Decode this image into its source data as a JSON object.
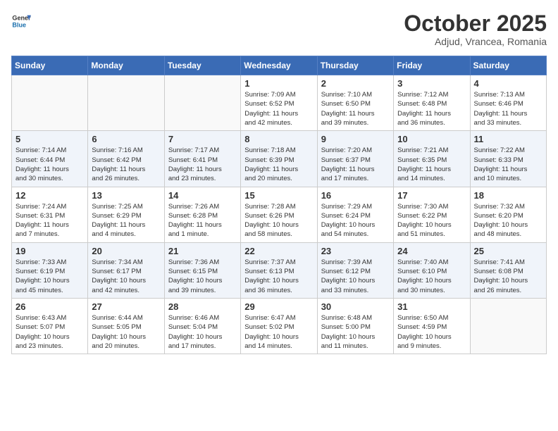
{
  "header": {
    "logo_line1": "General",
    "logo_line2": "Blue",
    "month": "October 2025",
    "location": "Adjud, Vrancea, Romania"
  },
  "weekdays": [
    "Sunday",
    "Monday",
    "Tuesday",
    "Wednesday",
    "Thursday",
    "Friday",
    "Saturday"
  ],
  "weeks": [
    [
      {
        "day": "",
        "info": ""
      },
      {
        "day": "",
        "info": ""
      },
      {
        "day": "",
        "info": ""
      },
      {
        "day": "1",
        "info": "Sunrise: 7:09 AM\nSunset: 6:52 PM\nDaylight: 11 hours\nand 42 minutes."
      },
      {
        "day": "2",
        "info": "Sunrise: 7:10 AM\nSunset: 6:50 PM\nDaylight: 11 hours\nand 39 minutes."
      },
      {
        "day": "3",
        "info": "Sunrise: 7:12 AM\nSunset: 6:48 PM\nDaylight: 11 hours\nand 36 minutes."
      },
      {
        "day": "4",
        "info": "Sunrise: 7:13 AM\nSunset: 6:46 PM\nDaylight: 11 hours\nand 33 minutes."
      }
    ],
    [
      {
        "day": "5",
        "info": "Sunrise: 7:14 AM\nSunset: 6:44 PM\nDaylight: 11 hours\nand 30 minutes."
      },
      {
        "day": "6",
        "info": "Sunrise: 7:16 AM\nSunset: 6:42 PM\nDaylight: 11 hours\nand 26 minutes."
      },
      {
        "day": "7",
        "info": "Sunrise: 7:17 AM\nSunset: 6:41 PM\nDaylight: 11 hours\nand 23 minutes."
      },
      {
        "day": "8",
        "info": "Sunrise: 7:18 AM\nSunset: 6:39 PM\nDaylight: 11 hours\nand 20 minutes."
      },
      {
        "day": "9",
        "info": "Sunrise: 7:20 AM\nSunset: 6:37 PM\nDaylight: 11 hours\nand 17 minutes."
      },
      {
        "day": "10",
        "info": "Sunrise: 7:21 AM\nSunset: 6:35 PM\nDaylight: 11 hours\nand 14 minutes."
      },
      {
        "day": "11",
        "info": "Sunrise: 7:22 AM\nSunset: 6:33 PM\nDaylight: 11 hours\nand 10 minutes."
      }
    ],
    [
      {
        "day": "12",
        "info": "Sunrise: 7:24 AM\nSunset: 6:31 PM\nDaylight: 11 hours\nand 7 minutes."
      },
      {
        "day": "13",
        "info": "Sunrise: 7:25 AM\nSunset: 6:29 PM\nDaylight: 11 hours\nand 4 minutes."
      },
      {
        "day": "14",
        "info": "Sunrise: 7:26 AM\nSunset: 6:28 PM\nDaylight: 11 hours\nand 1 minute."
      },
      {
        "day": "15",
        "info": "Sunrise: 7:28 AM\nSunset: 6:26 PM\nDaylight: 10 hours\nand 58 minutes."
      },
      {
        "day": "16",
        "info": "Sunrise: 7:29 AM\nSunset: 6:24 PM\nDaylight: 10 hours\nand 54 minutes."
      },
      {
        "day": "17",
        "info": "Sunrise: 7:30 AM\nSunset: 6:22 PM\nDaylight: 10 hours\nand 51 minutes."
      },
      {
        "day": "18",
        "info": "Sunrise: 7:32 AM\nSunset: 6:20 PM\nDaylight: 10 hours\nand 48 minutes."
      }
    ],
    [
      {
        "day": "19",
        "info": "Sunrise: 7:33 AM\nSunset: 6:19 PM\nDaylight: 10 hours\nand 45 minutes."
      },
      {
        "day": "20",
        "info": "Sunrise: 7:34 AM\nSunset: 6:17 PM\nDaylight: 10 hours\nand 42 minutes."
      },
      {
        "day": "21",
        "info": "Sunrise: 7:36 AM\nSunset: 6:15 PM\nDaylight: 10 hours\nand 39 minutes."
      },
      {
        "day": "22",
        "info": "Sunrise: 7:37 AM\nSunset: 6:13 PM\nDaylight: 10 hours\nand 36 minutes."
      },
      {
        "day": "23",
        "info": "Sunrise: 7:39 AM\nSunset: 6:12 PM\nDaylight: 10 hours\nand 33 minutes."
      },
      {
        "day": "24",
        "info": "Sunrise: 7:40 AM\nSunset: 6:10 PM\nDaylight: 10 hours\nand 30 minutes."
      },
      {
        "day": "25",
        "info": "Sunrise: 7:41 AM\nSunset: 6:08 PM\nDaylight: 10 hours\nand 26 minutes."
      }
    ],
    [
      {
        "day": "26",
        "info": "Sunrise: 6:43 AM\nSunset: 5:07 PM\nDaylight: 10 hours\nand 23 minutes."
      },
      {
        "day": "27",
        "info": "Sunrise: 6:44 AM\nSunset: 5:05 PM\nDaylight: 10 hours\nand 20 minutes."
      },
      {
        "day": "28",
        "info": "Sunrise: 6:46 AM\nSunset: 5:04 PM\nDaylight: 10 hours\nand 17 minutes."
      },
      {
        "day": "29",
        "info": "Sunrise: 6:47 AM\nSunset: 5:02 PM\nDaylight: 10 hours\nand 14 minutes."
      },
      {
        "day": "30",
        "info": "Sunrise: 6:48 AM\nSunset: 5:00 PM\nDaylight: 10 hours\nand 11 minutes."
      },
      {
        "day": "31",
        "info": "Sunrise: 6:50 AM\nSunset: 4:59 PM\nDaylight: 10 hours\nand 9 minutes."
      },
      {
        "day": "",
        "info": ""
      }
    ]
  ]
}
